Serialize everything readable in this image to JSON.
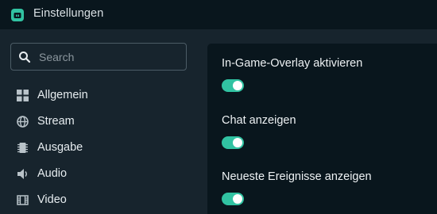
{
  "window": {
    "title": "Einstellungen",
    "app_icon": "streamlabs-app-icon",
    "accent_color": "#31c3a2"
  },
  "sidebar": {
    "search": {
      "placeholder": "Search",
      "value": "",
      "icon": "search-icon"
    },
    "items": [
      {
        "label": "Allgemein",
        "icon": "grid-icon"
      },
      {
        "label": "Stream",
        "icon": "globe-icon"
      },
      {
        "label": "Ausgabe",
        "icon": "chip-icon"
      },
      {
        "label": "Audio",
        "icon": "speaker-icon"
      },
      {
        "label": "Video",
        "icon": "film-icon"
      }
    ]
  },
  "settings": [
    {
      "label": "In-Game-Overlay aktivieren",
      "enabled": true
    },
    {
      "label": "Chat anzeigen",
      "enabled": true
    },
    {
      "label": "Neueste Ereignisse anzeigen",
      "enabled": true
    }
  ]
}
